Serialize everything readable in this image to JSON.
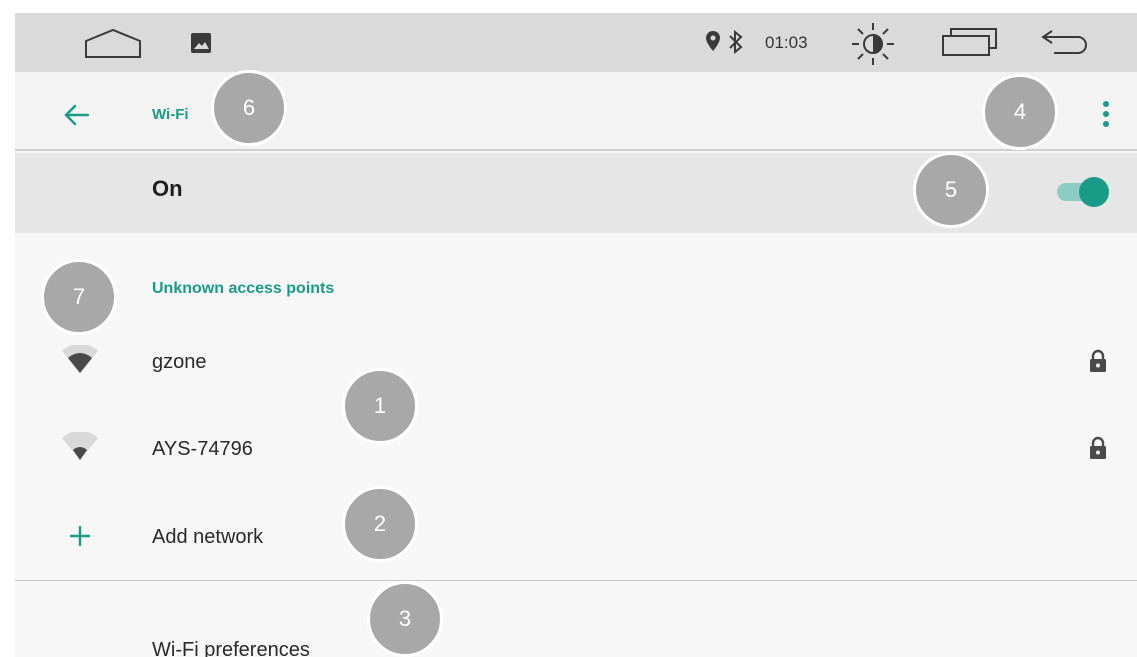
{
  "status_bar": {
    "time": "01:03",
    "icons": [
      "home-outline-icon",
      "picture-icon",
      "location-pin-icon",
      "bluetooth-icon",
      "brightness-icon",
      "recents-icon",
      "back-arrow-icon"
    ]
  },
  "toolbar": {
    "title": "Wi-Fi",
    "back_icon": "left-arrow-icon",
    "menu_icon": "overflow-menu-icon"
  },
  "master_switch": {
    "label": "On",
    "state": "on"
  },
  "section": {
    "header": "Unknown access points"
  },
  "networks": [
    {
      "name": "gzone",
      "icon": "wifi-signal-icon",
      "secured": true
    },
    {
      "name": "AYS-74796",
      "icon": "wifi-signal-icon",
      "secured": true
    }
  ],
  "add_network": {
    "label": "Add network",
    "icon": "plus-icon"
  },
  "preferences": {
    "label": "Wi-Fi preferences"
  },
  "callouts": [
    "1",
    "2",
    "3",
    "4",
    "5",
    "6",
    "7"
  ],
  "colors": {
    "accent": "#1a9b88",
    "status_bar": "#dadada",
    "switch_bar": "#e6e6e6",
    "callout": "#a8a8a8"
  }
}
